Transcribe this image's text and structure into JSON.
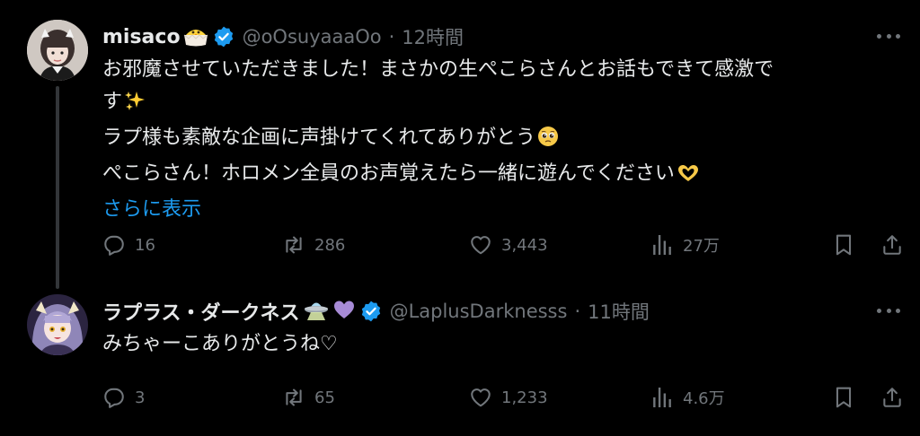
{
  "tweets": [
    {
      "display_name": "misaco",
      "name_emoji": "hatching-chick-icon",
      "handle": "@oOsuyaaaOo",
      "separator": "·",
      "time": "12時間",
      "text_lines": [
        "お邪魔させていただきました！まさかの生ぺこらさんとお話もできて感激で",
        "す",
        "ラプ様も素敵な企画に声掛けてくれてありがとう",
        "ぺこらさん！ホロメン全員のお声覚えたら一緒に遊んでください"
      ],
      "show_more": "さらに表示",
      "replies": "16",
      "retweets": "286",
      "likes": "3,443",
      "views": "27万"
    },
    {
      "display_name": "ラプラス・ダークネス",
      "name_emoji": "ufo-icon purple-heart-icon",
      "handle": "@LaplusDarknesss",
      "separator": "·",
      "time": "11時間",
      "text": "みちゃーこありがとうね♡",
      "replies": "3",
      "retweets": "65",
      "likes": "1,233",
      "views": "4.6万"
    }
  ],
  "colors": {
    "background": "#000000",
    "text": "#e7e9ea",
    "secondary": "#71767b",
    "link": "#1d9bf0",
    "verified": "#1d9bf0",
    "thread_line": "#333639"
  }
}
